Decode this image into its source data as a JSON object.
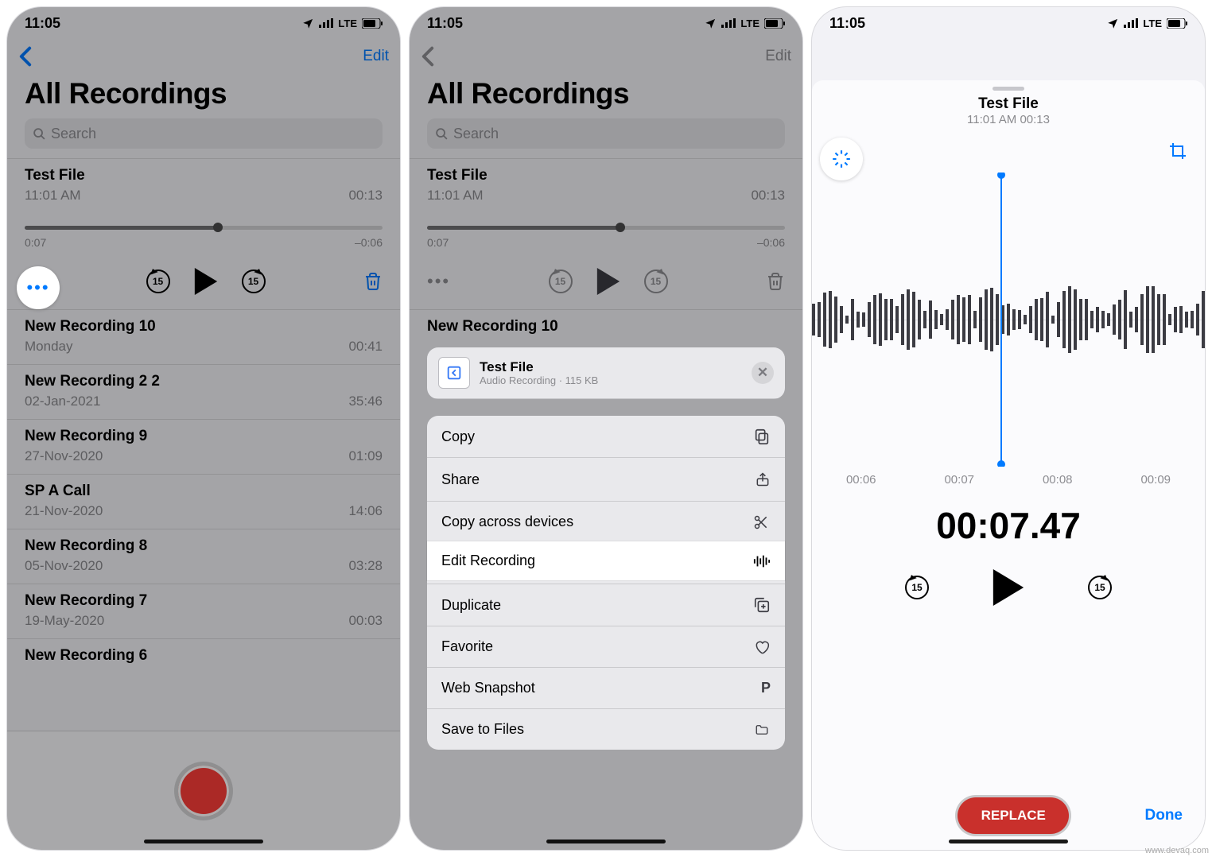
{
  "status": {
    "time": "11:05",
    "net": "LTE"
  },
  "nav": {
    "edit": "Edit"
  },
  "title": "All Recordings",
  "search": {
    "placeholder": "Search"
  },
  "current": {
    "name": "Test File",
    "subtitle": "11:01 AM",
    "duration": "00:13",
    "elapsed": "0:07",
    "remaining": "–0:06",
    "skip": "15"
  },
  "recordings": [
    {
      "name": "New Recording 10",
      "sub": "Monday",
      "dur": "00:41"
    },
    {
      "name": "New Recording 2 2",
      "sub": "02-Jan-2021",
      "dur": "35:46"
    },
    {
      "name": "New Recording 9",
      "sub": "27-Nov-2020",
      "dur": "01:09"
    },
    {
      "name": "SP A Call",
      "sub": "21-Nov-2020",
      "dur": "14:06"
    },
    {
      "name": "New Recording 8",
      "sub": "05-Nov-2020",
      "dur": "03:28"
    },
    {
      "name": "New Recording 7",
      "sub": "19-May-2020",
      "dur": "00:03"
    },
    {
      "name": "New Recording 6",
      "sub": "",
      "dur": ""
    }
  ],
  "phone2": {
    "headingRow": "New Recording 10",
    "file": {
      "title": "Test File",
      "subtitle": "Audio Recording · 115 KB"
    },
    "menu": {
      "copy": "Copy",
      "share": "Share",
      "copyAcross": "Copy across devices",
      "editRecording": "Edit Recording",
      "duplicate": "Duplicate",
      "favorite": "Favorite",
      "webSnapshot": "Web Snapshot",
      "saveToFiles": "Save to Files"
    }
  },
  "phone3": {
    "title": "Test File",
    "subtitle": "11:01 AM  00:13",
    "ticks": [
      "00:06",
      "00:07",
      "00:08",
      "00:09"
    ],
    "time": "00:07.47",
    "skip": "15",
    "replace": "REPLACE",
    "done": "Done"
  },
  "watermark": "www.devaq.com"
}
